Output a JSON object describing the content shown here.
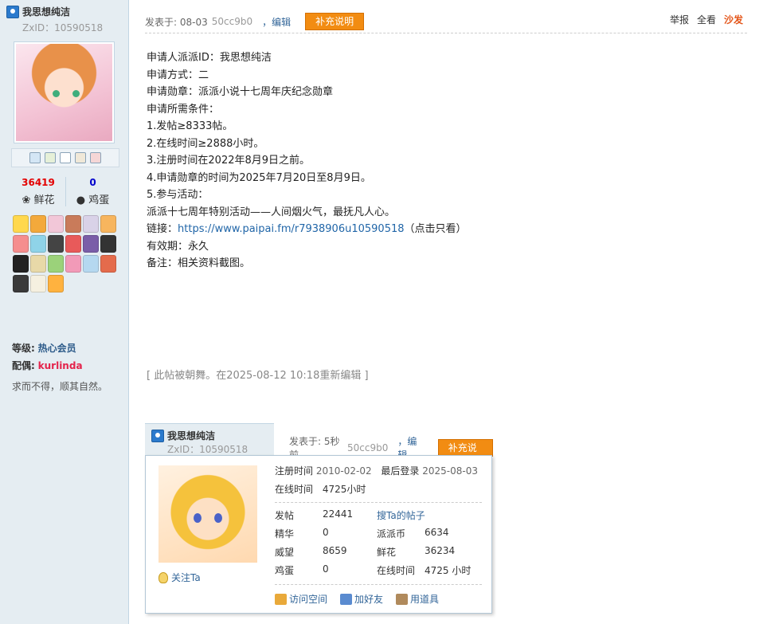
{
  "author": {
    "name": "我思想纯洁",
    "zxid": "ZxID：10590518",
    "flowers": "36419",
    "flowers_label": "鲜花",
    "eggs": "0",
    "eggs_label": "鸡蛋",
    "level_label": "等级:",
    "level_value": "热心会员",
    "mate_label": "配偶:",
    "mate_value": "kurlinda",
    "signature": "求而不得，顺其自然。"
  },
  "post": {
    "posted": "发表于: 08-03",
    "ip": "50cc9b0",
    "edit": "，编辑",
    "supplement": "补充说明",
    "tools": [
      "举报",
      "全看",
      "沙发"
    ],
    "lines": [
      "申请人派派ID：我思想纯洁",
      "申请方式：二",
      "申请勋章：派派小说十七周年庆纪念勋章",
      "申请所需条件：",
      "1.发帖≥8333帖。",
      "2.在线时间≥2888小时。",
      "3.注册时间在2022年8月9日之前。",
      "4.申请勋章的时间为2025年7月20日至8月9日。",
      "5.参与活动：",
      "派派十七周年特别活动——人间烟火气，最抚凡人心。"
    ],
    "link_prefix": "链接：",
    "link_url": "https://www.paipai.fm/r7938906u10590518",
    "link_suffix": "（点击只看）",
    "validity": "有效期：永久",
    "remark": "备注：相关资料截图。",
    "edited_note": "[ 此帖被朝舞。在2025-08-12 10:18重新编辑 ]"
  },
  "quote": {
    "name": "我思想纯洁",
    "zxid": "ZxID：10590518",
    "posted": "发表于: 5秒前",
    "ip": "50cc9b0",
    "edit": "，编辑",
    "supplement": "补充说明",
    "follow": "关注Ta",
    "reg_label": "注册时间",
    "reg_value": "2010-02-02",
    "last_label": "最后登录",
    "last_value": "2025-08-03",
    "online_label": "在线时间",
    "online_value": "4725小时",
    "grid": [
      {
        "k": "发帖",
        "v": "22441",
        "link": "搜Ta的帖子"
      },
      {
        "k": "精华",
        "v": "0",
        "k2": "派派币",
        "v2": "6634"
      },
      {
        "k": "威望",
        "v": "8659",
        "k2": "鲜花",
        "v2": "36234"
      },
      {
        "k": "鸡蛋",
        "v": "0",
        "k2": "在线时间",
        "v2": "4725 小时"
      }
    ],
    "actions": [
      "访问空间",
      "加好友",
      "用道具"
    ]
  }
}
